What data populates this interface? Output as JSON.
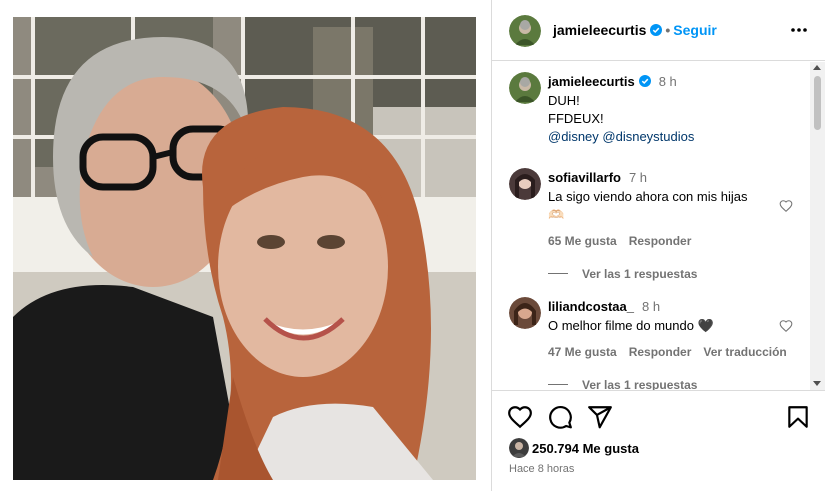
{
  "post": {
    "author": "jamieleecurtis",
    "follow_label": "Seguir",
    "separator": "•"
  },
  "caption": {
    "user": "jamieleecurtis",
    "time": "8 h",
    "lines": [
      "DUH!",
      "FFDEUX!"
    ],
    "mention_1": "@disney",
    "mention_2": "@disneystudios"
  },
  "comments": [
    {
      "user": "sofiavillarfo",
      "time": "7 h",
      "text": "La sigo viendo ahora con mis hijas",
      "text_line2": "🫶🏻",
      "likes": "65 Me gusta",
      "reply": "Responder",
      "view_replies": "Ver las 1 respuestas"
    },
    {
      "user": "liliandcostaa_",
      "time": "8 h",
      "text": "O melhor filme do mundo 🖤",
      "likes": "47 Me gusta",
      "reply": "Responder",
      "translate": "Ver traducción",
      "view_replies": "Ver las 1 respuestas"
    }
  ],
  "footer": {
    "likes": "250.794 Me gusta",
    "ago": "Hace 8 horas"
  },
  "icons": {
    "like": "heart-icon",
    "comment": "comment-icon",
    "share": "paper-plane-icon",
    "save": "bookmark-icon",
    "more": "more-horizontal-icon",
    "verified": "verified-badge-icon"
  },
  "colors": {
    "link_blue": "#0095f6",
    "verified_blue": "#0095f6",
    "mention_blue": "#00376b",
    "muted": "#737373",
    "border": "#dbdbdb"
  }
}
